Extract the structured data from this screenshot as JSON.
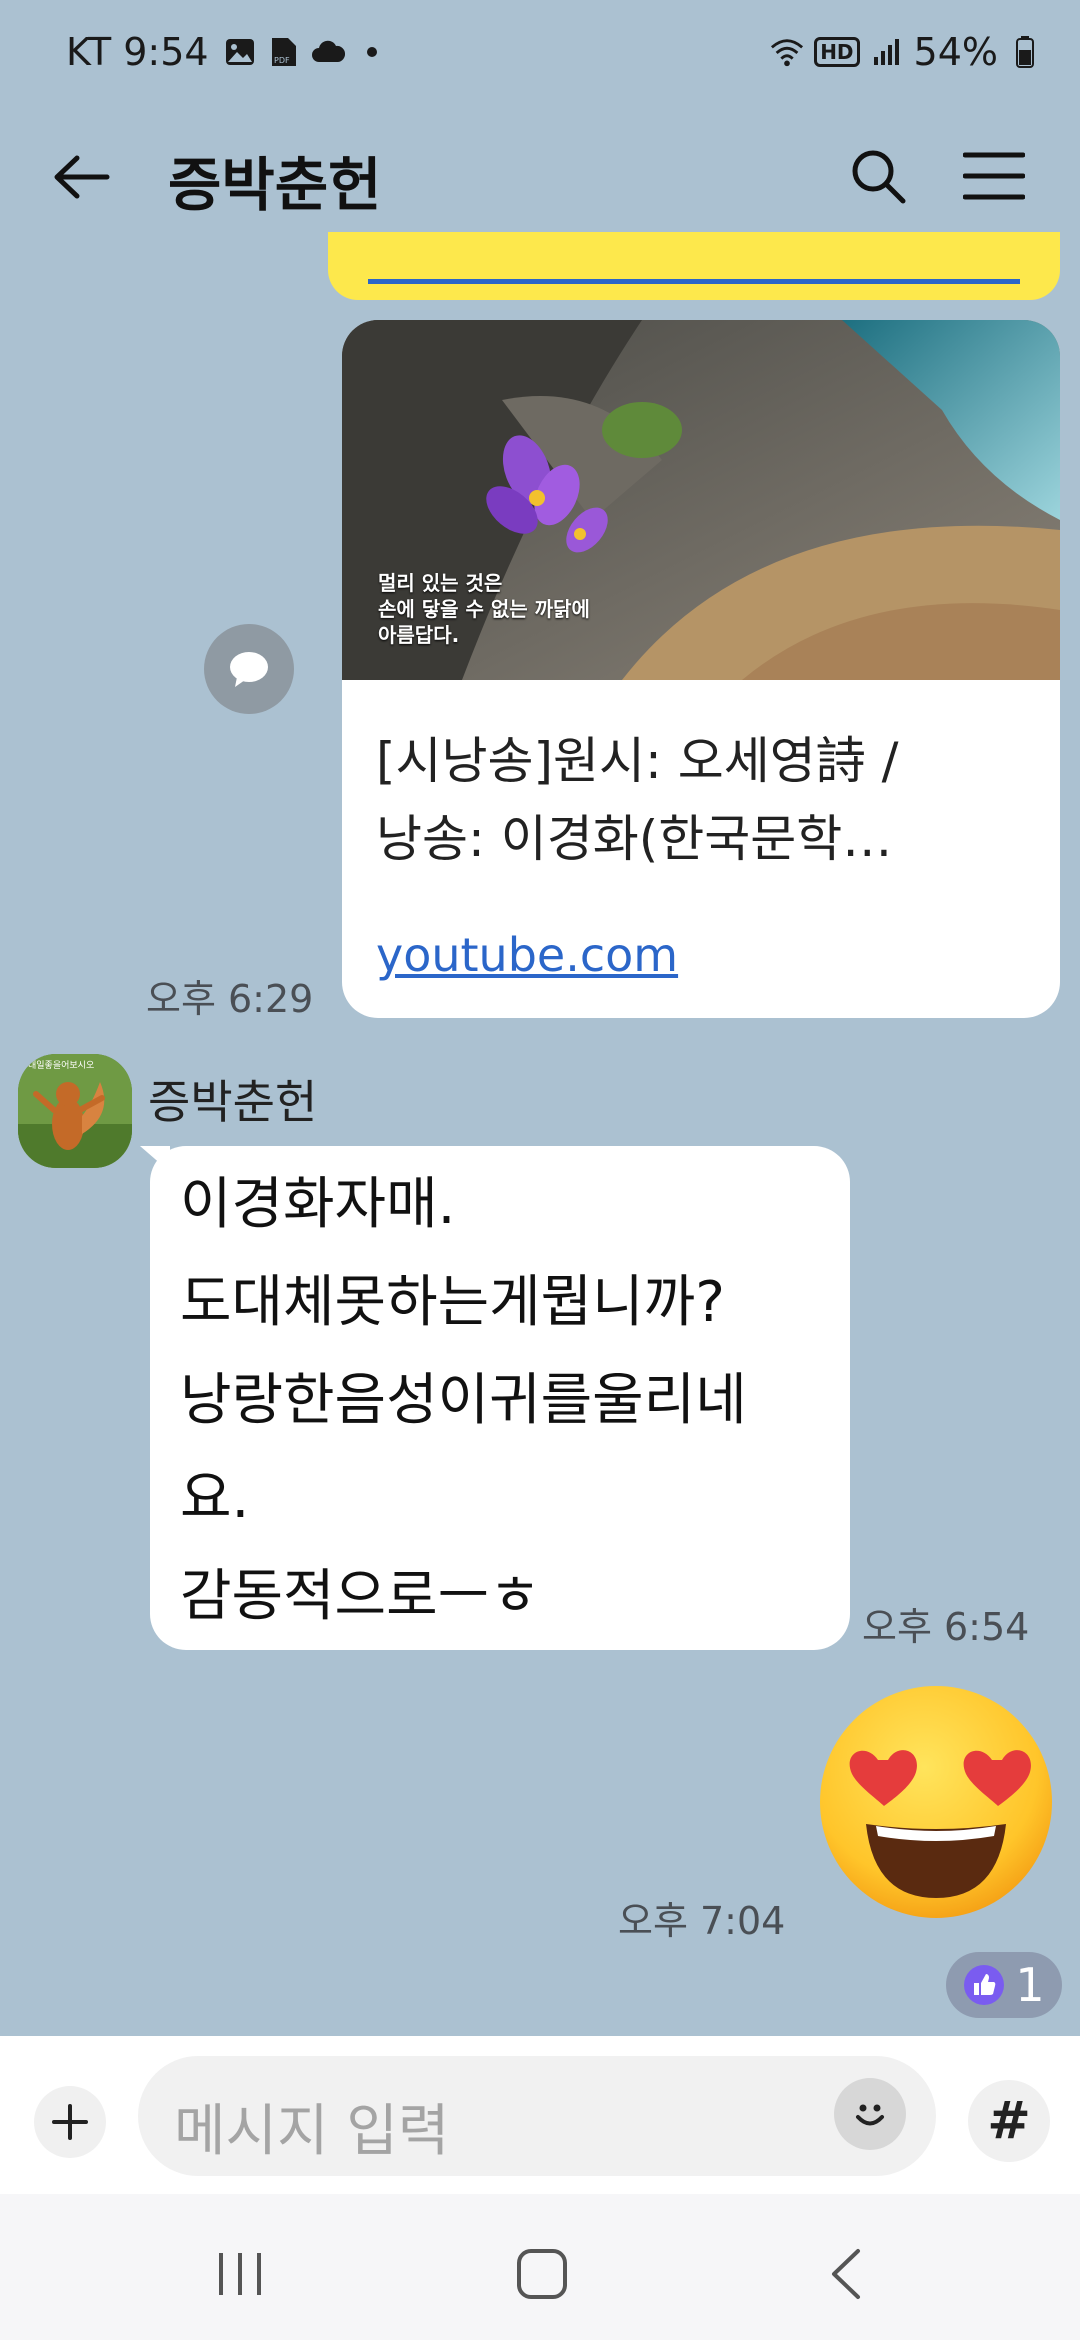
{
  "status_bar": {
    "carrier_time": "KT 9:54",
    "battery_percent": "54%",
    "hd_label": "HD",
    "icons": [
      "gallery-icon",
      "pdf-icon",
      "cloud-icon",
      "dot-icon",
      "wifi-icon",
      "hd-icon",
      "signal-icon",
      "battery-icon"
    ]
  },
  "header": {
    "title": "증박춘헌",
    "icons": [
      "back-arrow-icon",
      "search-icon",
      "hamburger-menu-icon"
    ]
  },
  "messages": {
    "link_card": {
      "thumbnail_caption": "멀리 있는 것은\n손에 닿을 수 없는 까닭에\n아름답다.",
      "title_line1": "[시낭송]원시: 오세영詩 /",
      "title_line2": "낭송: 이경화(한국문학…",
      "domain": "youtube.com",
      "time": "오후 6:29"
    },
    "incoming": {
      "sender": "증박춘헌",
      "avatar_caption": "내일좋을어보시오",
      "text": "이경화자매.\n도대체못하는게뭡니까?\n낭랑한음성이귀를울리네\n요.\n감동적으로ㅡㅎ",
      "time": "오후 6:54"
    },
    "emoji_message": {
      "emoji_name": "heart-eyes-emoji",
      "time": "오후 7:04",
      "reaction_count": "1",
      "reaction_icon": "thumbs-up-icon"
    }
  },
  "input_bar": {
    "placeholder": "메시지 입력",
    "hash_label": "#",
    "icons": [
      "plus-icon",
      "emoji-icon"
    ]
  },
  "nav_bar": {
    "icons": [
      "recents-icon",
      "home-icon",
      "back-icon"
    ]
  },
  "colors": {
    "chat_background": "#abc1d1",
    "bubble_white": "#ffffff",
    "bubble_yellow": "#fde84c",
    "link_blue": "#2b66c9",
    "reaction_purple": "#7a5cf0"
  }
}
